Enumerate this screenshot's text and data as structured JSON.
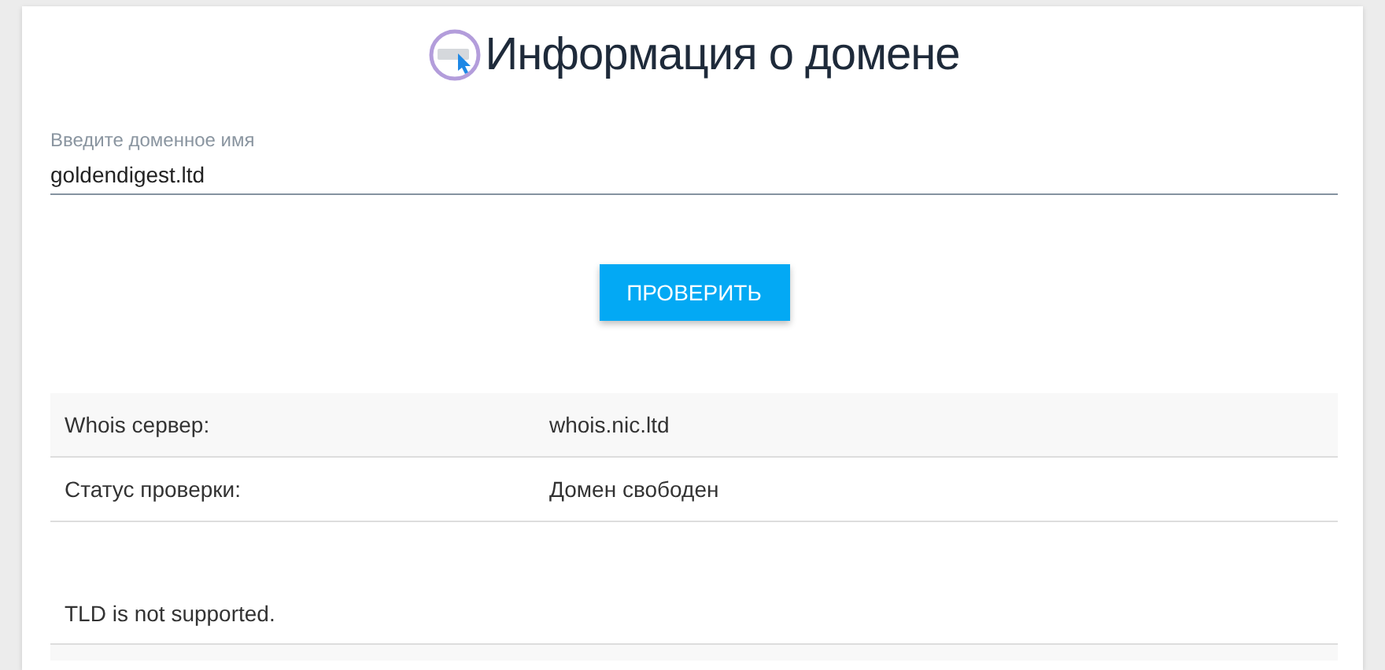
{
  "title": "Информация о домене",
  "domain_field": {
    "label": "Введите доменное имя",
    "value": "goldendigest.ltd"
  },
  "check_button": "ПРОВЕРИТЬ",
  "results": [
    {
      "label": "Whois сервер:",
      "value": "whois.nic.ltd"
    },
    {
      "label": "Статус проверки:",
      "value": "Домен свободен"
    }
  ],
  "message": "TLD is not supported."
}
